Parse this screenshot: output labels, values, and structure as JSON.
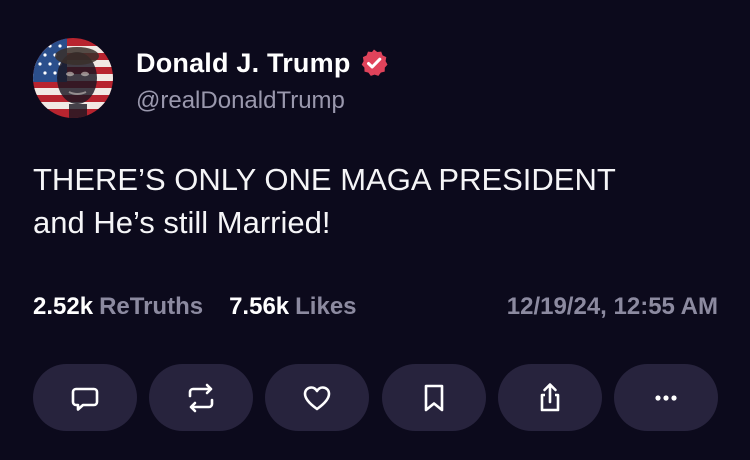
{
  "author": {
    "display_name": "Donald J. Trump",
    "handle": "@realDonaldTrump",
    "avatar_icon": "flag-portrait-avatar",
    "verified_icon": "verified-badge-icon",
    "verified_color": "#e0435b"
  },
  "post": {
    "line1": "THERE’S ONLY ONE MAGA PRESIDENT",
    "line2": "and He’s still Married!"
  },
  "stats": {
    "retruths_count": "2.52k",
    "retruths_label": "ReTruths",
    "likes_count": "7.56k",
    "likes_label": "Likes",
    "timestamp": "12/19/24, 12:55 AM"
  },
  "actions": [
    {
      "icon": "reply-icon"
    },
    {
      "icon": "retruth-icon"
    },
    {
      "icon": "like-heart-icon"
    },
    {
      "icon": "bookmark-icon"
    },
    {
      "icon": "share-icon"
    },
    {
      "icon": "more-options-icon"
    }
  ],
  "colors": {
    "background": "#0c0a1c",
    "button_bg": "#27233d",
    "muted_text": "#8c8aa0"
  }
}
